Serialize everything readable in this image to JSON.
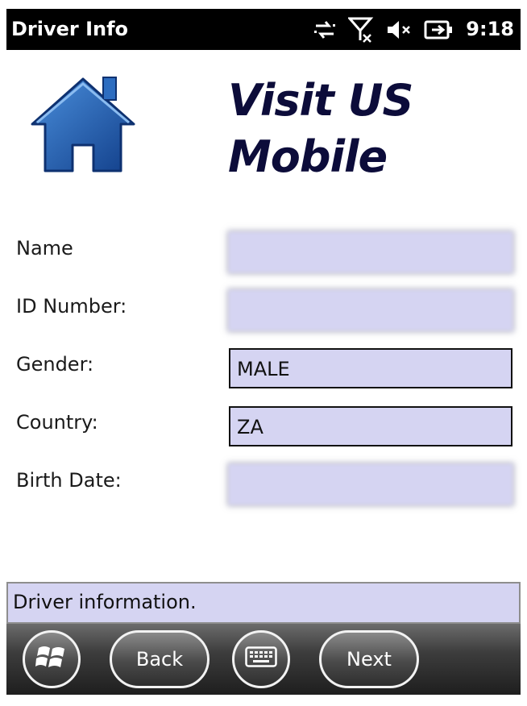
{
  "status_bar": {
    "app_title": "Driver Info",
    "time": "9:18",
    "icons": [
      "connectivity-icon",
      "no-signal-icon",
      "volume-muted-icon",
      "battery-charging-icon"
    ]
  },
  "header": {
    "logo_icon": "home-icon",
    "brand_line1": "Visit US",
    "brand_line2": "Mobile"
  },
  "form": {
    "name_label": "Name",
    "name_value": "",
    "id_label": "ID Number:",
    "id_value": "",
    "gender_label": "Gender:",
    "gender_value": "MALE",
    "country_label": "Country:",
    "country_value": "ZA",
    "birth_label": "Birth Date:",
    "birth_value": ""
  },
  "message": "Driver information.",
  "soft_keys": {
    "start_icon": "windows-start-icon",
    "back_label": "Back",
    "keyboard_icon": "keyboard-icon",
    "next_label": "Next"
  },
  "colors": {
    "field_bg": "#d5d4f2",
    "brand_text": "#0c0c3a",
    "home_blue": "#1f63b5"
  }
}
